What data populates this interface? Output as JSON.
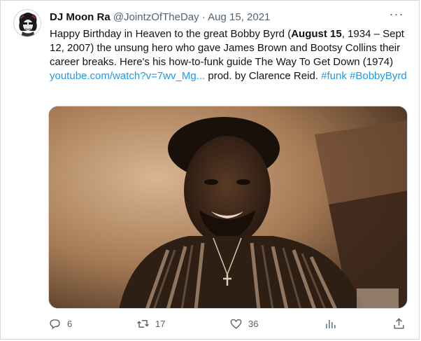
{
  "tweet": {
    "author_name": "DJ Moon Ra",
    "handle": "@JointzOfTheDay",
    "separator": "·",
    "date": "Aug 15, 2021",
    "more_label": "···",
    "text": {
      "part1": "Happy Birthday in Heaven to the great Bobby Byrd (",
      "bold": "August 15",
      "part2": ", 1934 – Sept 12, 2007) the unsung hero who gave James Brown and Bootsy Collins their career breaks. Here's his how-to-funk guide The Way To Get Down (1974) ",
      "link": "youtube.com/watch?v=7wv_Mg...",
      "part3": " prod. by Clarence Reid. ",
      "hashtag1": "#funk",
      "hashtag2": "#BobbyByrd"
    }
  },
  "actions": {
    "reply_count": "6",
    "retweet_count": "17",
    "like_count": "36"
  },
  "icons": {
    "reply": "reply-icon",
    "retweet": "retweet-icon",
    "like": "like-icon",
    "views": "views-icon",
    "share": "share-icon"
  },
  "colors": {
    "link": "#1d9bf0",
    "muted": "#536471",
    "text": "#0f1419"
  }
}
